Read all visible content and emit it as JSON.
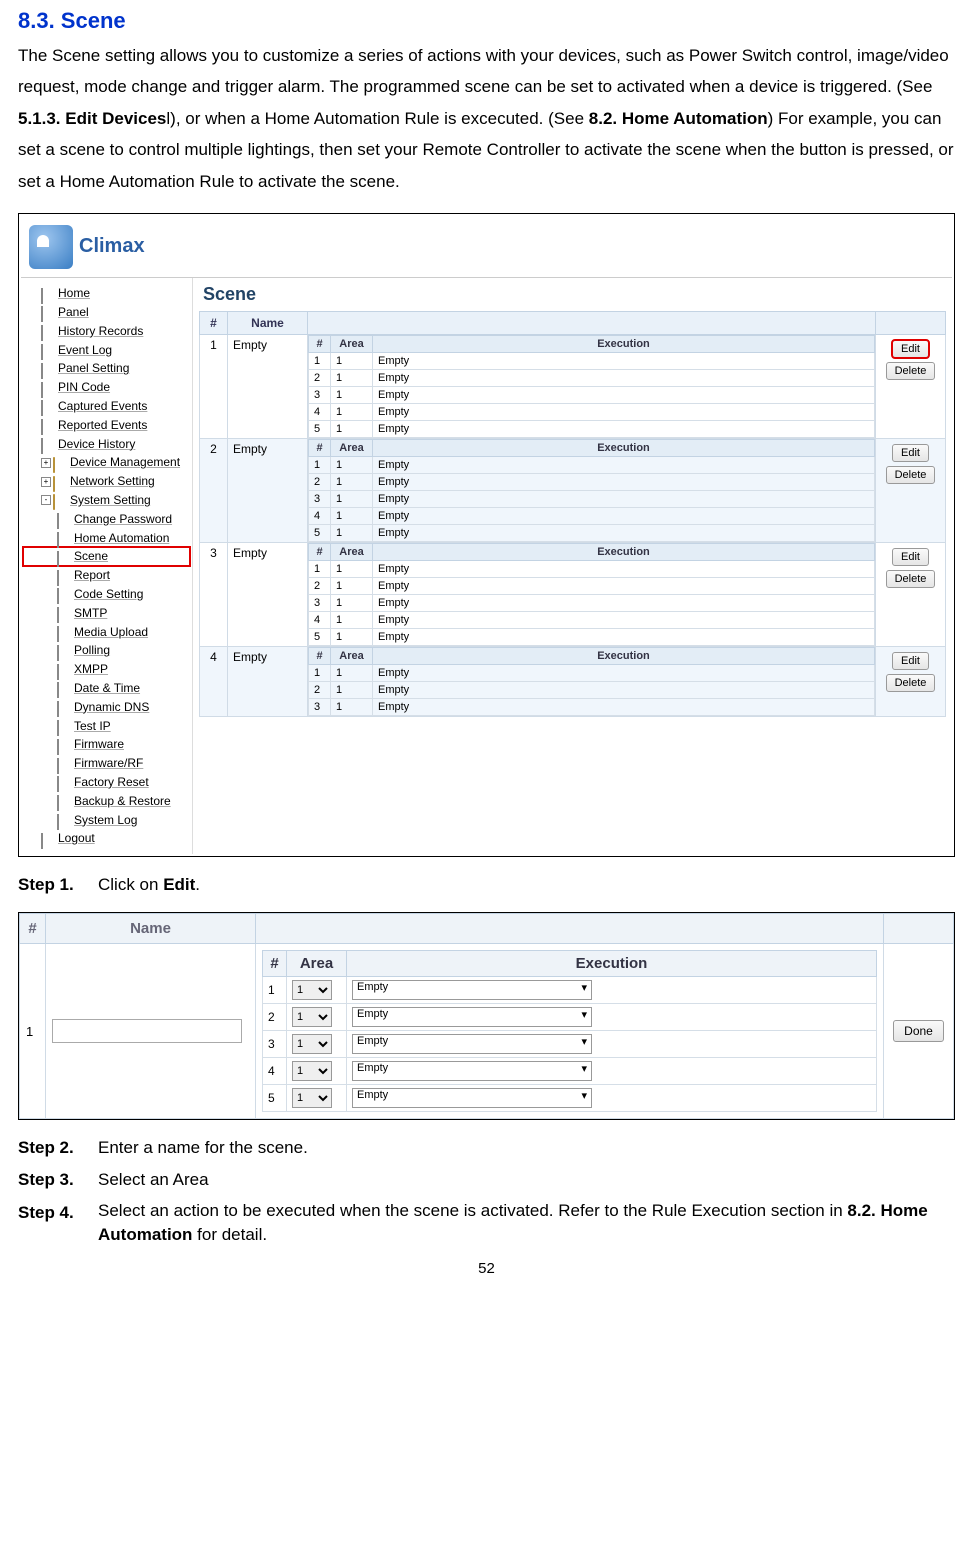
{
  "heading": "8.3. Scene",
  "intro_segments": [
    {
      "t": "The Scene setting allows you to customize a series of actions with your devices, such as Power Switch control, image/video request, mode change and trigger alarm. The programmed scene can be set to activated when a device is triggered. (See ",
      "b": false
    },
    {
      "t": "5.1.3. Edit Devices",
      "b": true
    },
    {
      "t": "l), or when a Home Automation Rule is excecuted. (See ",
      "b": false
    },
    {
      "t": "8.2. Home Automation",
      "b": true
    },
    {
      "t": ") For example, you can set a scene to control multiple lightings, then set your Remote Controller to activate the scene when the button is pressed, or set a Home Automation Rule to activate the scene.",
      "b": false
    }
  ],
  "logo_text": "Climax",
  "nav": [
    {
      "label": "Home",
      "type": "page",
      "indent": 1
    },
    {
      "label": "Panel",
      "type": "page",
      "indent": 1
    },
    {
      "label": "History Records",
      "type": "page",
      "indent": 1
    },
    {
      "label": "Event Log",
      "type": "page",
      "indent": 1
    },
    {
      "label": "Panel Setting",
      "type": "page",
      "indent": 1
    },
    {
      "label": "PIN Code",
      "type": "page",
      "indent": 1
    },
    {
      "label": "Captured Events",
      "type": "page",
      "indent": 1
    },
    {
      "label": "Reported Events",
      "type": "page",
      "indent": 1
    },
    {
      "label": "Device History",
      "type": "page",
      "indent": 1
    },
    {
      "label": "Device Management",
      "type": "folder",
      "indent": 1,
      "expand": "+"
    },
    {
      "label": "Network Setting",
      "type": "folder",
      "indent": 1,
      "expand": "+"
    },
    {
      "label": "System Setting",
      "type": "folder",
      "indent": 1,
      "expand": "-"
    },
    {
      "label": "Change Password",
      "type": "page",
      "indent": 2
    },
    {
      "label": "Home Automation",
      "type": "page",
      "indent": 2
    },
    {
      "label": "Scene",
      "type": "page",
      "indent": 2,
      "selected": true
    },
    {
      "label": "Report",
      "type": "page",
      "indent": 2
    },
    {
      "label": "Code Setting",
      "type": "page",
      "indent": 2
    },
    {
      "label": "SMTP",
      "type": "page",
      "indent": 2
    },
    {
      "label": "Media Upload",
      "type": "page",
      "indent": 2
    },
    {
      "label": "Polling",
      "type": "page",
      "indent": 2
    },
    {
      "label": "XMPP",
      "type": "page",
      "indent": 2
    },
    {
      "label": "Date & Time",
      "type": "page",
      "indent": 2
    },
    {
      "label": "Dynamic DNS",
      "type": "page",
      "indent": 2
    },
    {
      "label": "Test IP",
      "type": "page",
      "indent": 2
    },
    {
      "label": "Firmware",
      "type": "page",
      "indent": 2
    },
    {
      "label": "Firmware/RF",
      "type": "page",
      "indent": 2
    },
    {
      "label": "Factory Reset",
      "type": "page",
      "indent": 2
    },
    {
      "label": "Backup & Restore",
      "type": "page",
      "indent": 2
    },
    {
      "label": "System Log",
      "type": "page",
      "indent": 2
    },
    {
      "label": "Logout",
      "type": "page",
      "indent": 1
    }
  ],
  "scene_header": "Scene",
  "cols": {
    "num": "#",
    "name": "Name",
    "area": "Area",
    "exec": "Execution"
  },
  "empty_label": "Empty",
  "btn_edit": "Edit",
  "btn_delete": "Delete",
  "btn_done": "Done",
  "scene_rows": [
    1,
    2,
    3,
    4
  ],
  "inner_rows": [
    1,
    2,
    3,
    4,
    5
  ],
  "area_default": "1",
  "edit_options": {
    "area": "1",
    "exec": "Empty"
  },
  "steps": [
    {
      "label": "Step 1.",
      "segs": [
        {
          "t": "Click on ",
          "b": false
        },
        {
          "t": "Edit",
          "b": true
        },
        {
          "t": ".",
          "b": false
        }
      ]
    },
    {
      "label": "Step 2.",
      "segs": [
        {
          "t": "Enter a name for the scene.",
          "b": false
        }
      ]
    },
    {
      "label": "Step 3.",
      "segs": [
        {
          "t": "Select an Area",
          "b": false
        }
      ]
    },
    {
      "label": "Step 4.",
      "segs": [
        {
          "t": "Select an action to be executed when the scene is activated. Refer to the Rule Execution section in ",
          "b": false
        },
        {
          "t": "8.2. Home Automation",
          "b": true
        },
        {
          "t": " for detail.",
          "b": false
        }
      ]
    }
  ],
  "edit_row_num": "1",
  "page_number": "52"
}
